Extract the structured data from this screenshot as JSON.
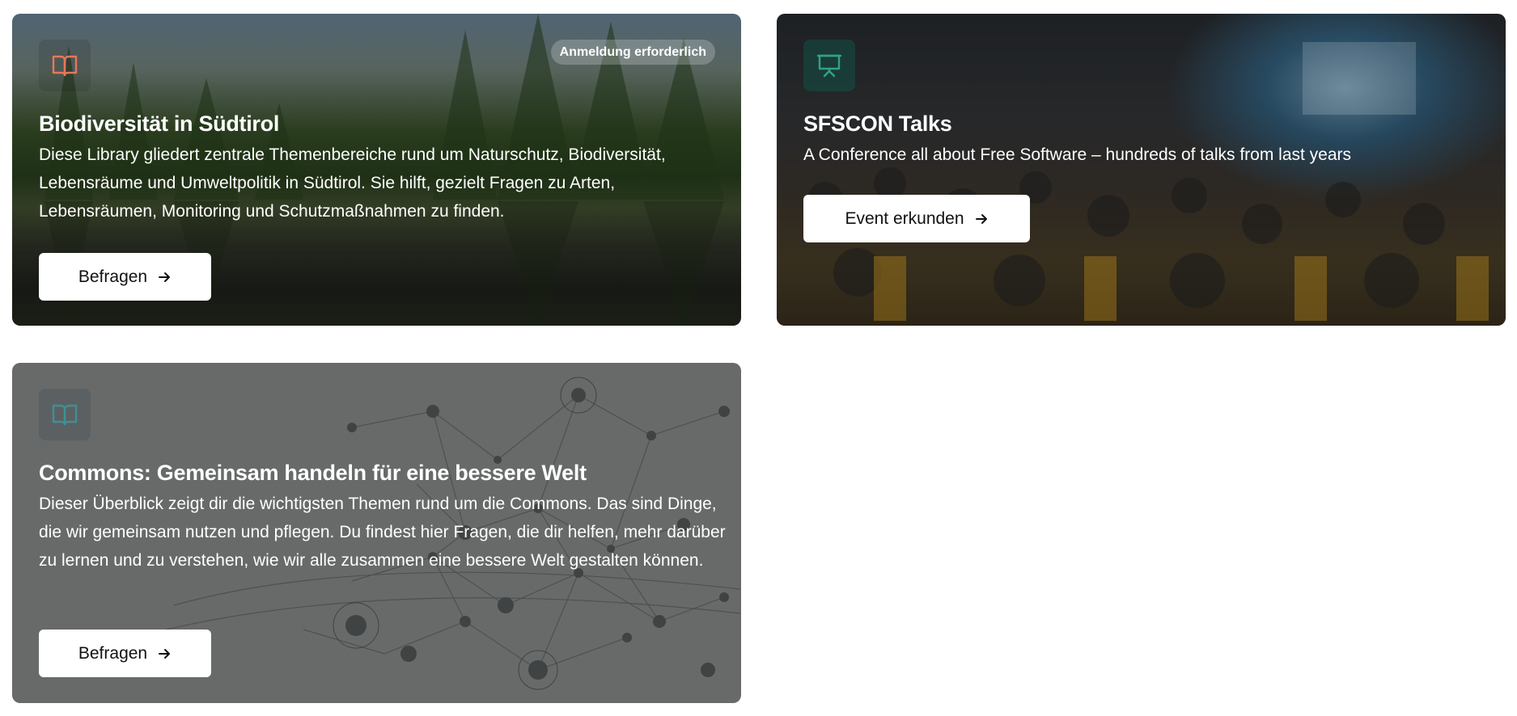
{
  "colors": {
    "book_icon_orange": "#e8765a",
    "book_icon_teal": "#3f8f96",
    "presentation_icon_teal": "#2fa28a",
    "button_bg": "#ffffff",
    "button_text": "#111111"
  },
  "cards": [
    {
      "icon": "book-open-icon",
      "badge": "Anmeldung erforderlich",
      "title": "Biodiversität in Südtirol",
      "description": "Diese Library gliedert zentrale Themenbereiche rund um Naturschutz, Biodiversität, Lebensräume und Umweltpolitik in Südtirol. Sie hilft, gezielt Fragen zu Arten, Lebensräumen, Monitoring und Schutzmaßnahmen zu finden.",
      "button_label": "Befragen"
    },
    {
      "icon": "presentation-icon",
      "title": "SFSCON Talks",
      "description": "A Conference all about Free Software – hundreds of talks from last years",
      "button_label": "Event erkunden"
    },
    {
      "icon": "book-open-icon",
      "title": "Commons: Gemeinsam handeln für eine bessere Welt",
      "description": "Dieser Überblick zeigt dir die wichtigsten Themen rund um die Commons. Das sind Dinge, die wir gemeinsam nutzen und pflegen. Du findest hier Fragen, die dir helfen, mehr darüber zu lernen und zu verstehen, wie wir alle zusammen eine bessere Welt gestalten können.",
      "button_label": "Befragen"
    }
  ]
}
